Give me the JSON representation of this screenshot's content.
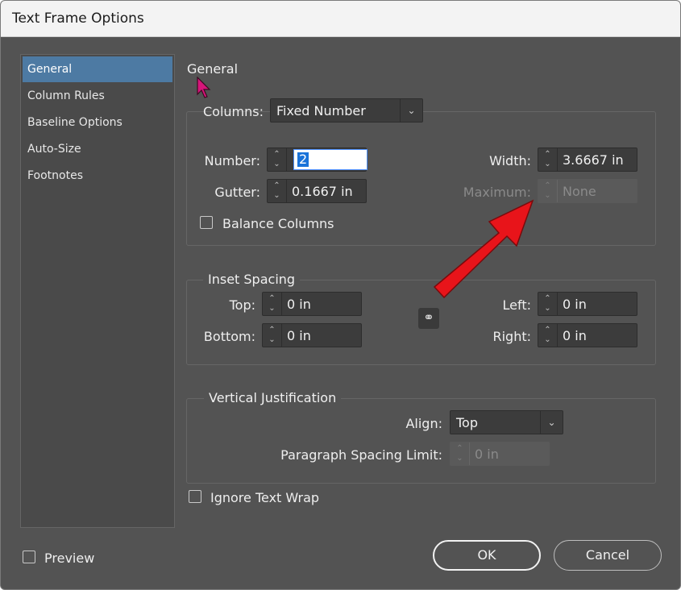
{
  "window": {
    "title": "Text Frame Options"
  },
  "sidebar": {
    "items": [
      {
        "label": "General",
        "selected": true
      },
      {
        "label": "Column Rules"
      },
      {
        "label": "Baseline Options"
      },
      {
        "label": "Auto-Size"
      },
      {
        "label": "Footnotes"
      }
    ]
  },
  "main": {
    "heading": "General",
    "columns": {
      "label": "Columns:",
      "type_value": "Fixed Number",
      "number_label": "Number:",
      "number_value": "2",
      "gutter_label": "Gutter:",
      "gutter_value": "0.1667 in",
      "width_label": "Width:",
      "width_value": "3.6667 in",
      "maximum_label": "Maximum:",
      "maximum_value": "None",
      "balance_label": "Balance Columns",
      "balance_checked": false
    },
    "inset": {
      "legend": "Inset Spacing",
      "top_label": "Top:",
      "top_value": "0 in",
      "bottom_label": "Bottom:",
      "bottom_value": "0 in",
      "left_label": "Left:",
      "left_value": "0 in",
      "right_label": "Right:",
      "right_value": "0 in"
    },
    "vertical": {
      "legend": "Vertical Justification",
      "align_label": "Align:",
      "align_value": "Top",
      "para_label": "Paragraph Spacing Limit:",
      "para_value": "0 in"
    },
    "ignore_wrap": {
      "label": "Ignore Text Wrap",
      "checked": false
    }
  },
  "footer": {
    "preview_label": "Preview",
    "preview_checked": false,
    "ok_label": "OK",
    "cancel_label": "Cancel"
  },
  "colors": {
    "selection": "#4d7aa3",
    "annotation_arrow": "#e8141a",
    "cursor": "#d6157a"
  }
}
